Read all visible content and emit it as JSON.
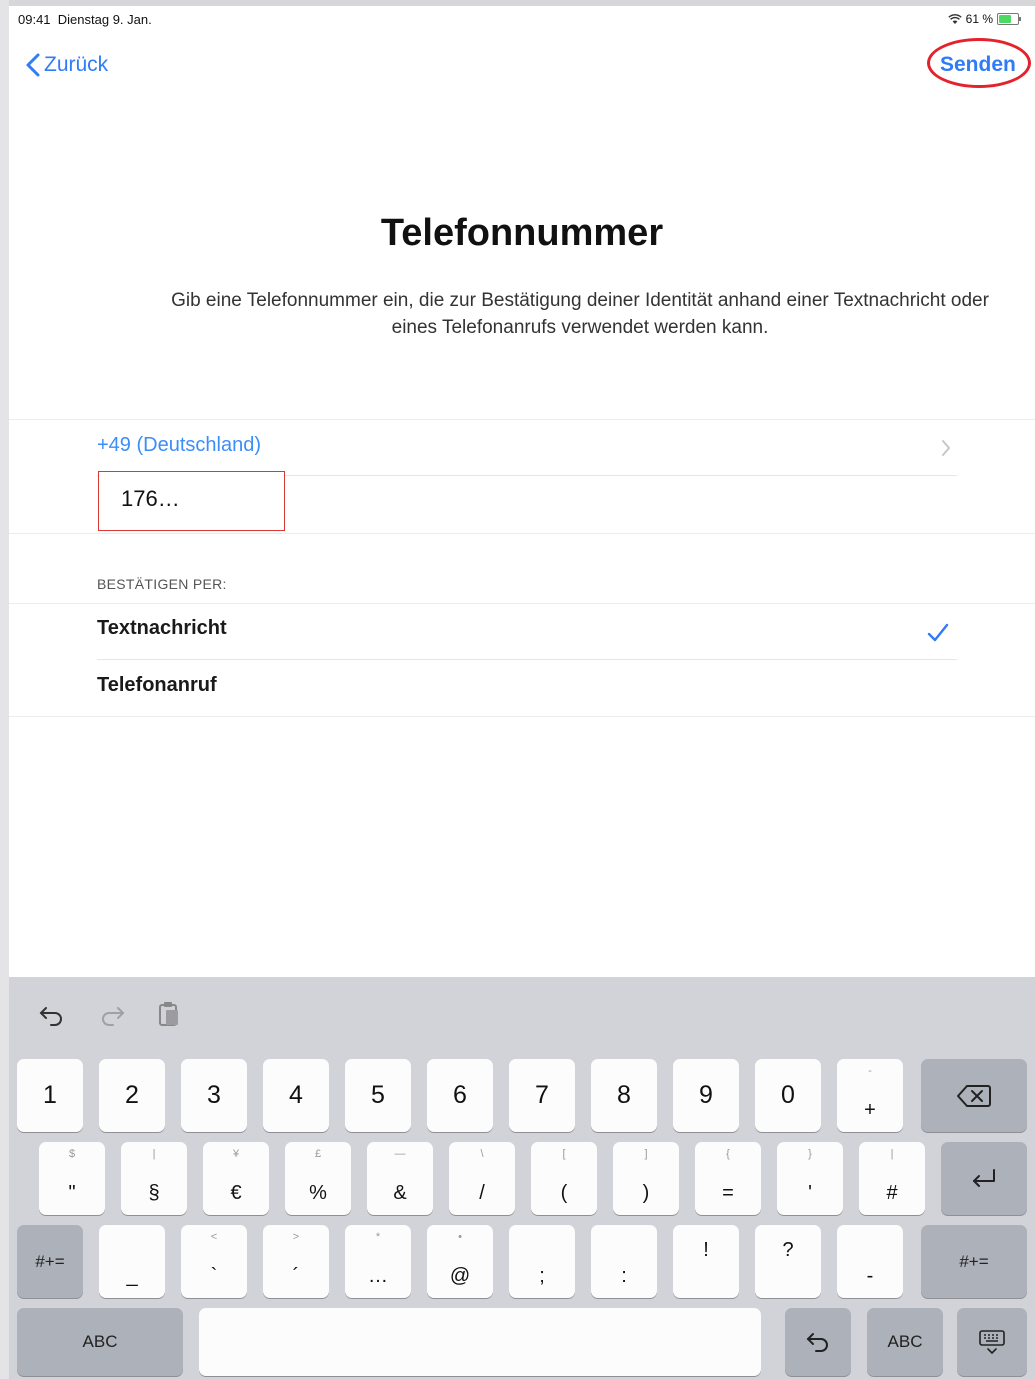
{
  "status_bar": {
    "time": "09:41",
    "date": "Dienstag 9. Jan.",
    "battery": "61 %"
  },
  "nav": {
    "back_label": "Zurück",
    "send_label": "Senden"
  },
  "title": "Telefonnummer",
  "description": "Gib eine Telefonnummer ein, die zur Bestätigung deiner Identität anhand einer Textnachricht oder eines Telefonanrufs verwendet werden kann.",
  "country": "+49 (Deutschland)",
  "phone_value": "176…",
  "verify_header": "BESTÄTIGEN PER:",
  "verify_options": [
    "Textnachricht",
    "Telefonanruf"
  ],
  "selected_option": "Textnachricht",
  "accent_color": "#2f7cf6",
  "highlight_color": "#e4222c",
  "keyboard": {
    "row1": [
      "1",
      "2",
      "3",
      "4",
      "5",
      "6",
      "7",
      "8",
      "9",
      "0",
      "+"
    ],
    "row1_hint": [
      "",
      "",
      "",
      "",
      "",
      "",
      "",
      "",
      "",
      "",
      "-"
    ],
    "row2": [
      "\"",
      "§",
      "€",
      "%",
      "&",
      "/",
      "(",
      ")",
      "=",
      "'",
      "#"
    ],
    "row2_hint": [
      "$",
      "|",
      "¥",
      "£",
      "—",
      "\\",
      "[",
      "]",
      "{",
      "}",
      "|"
    ],
    "row3": [
      "_",
      "`",
      "´",
      "…",
      "@",
      ";",
      ":",
      "!",
      "?",
      "-"
    ],
    "row3_hint": [
      "",
      "<",
      ">",
      "*",
      "•",
      "",
      "",
      "",
      "",
      ""
    ],
    "shift_label": "#+=",
    "abc_label": "ABC",
    "toolbar_icons": [
      "undo-icon",
      "redo-icon",
      "paste-icon"
    ]
  }
}
